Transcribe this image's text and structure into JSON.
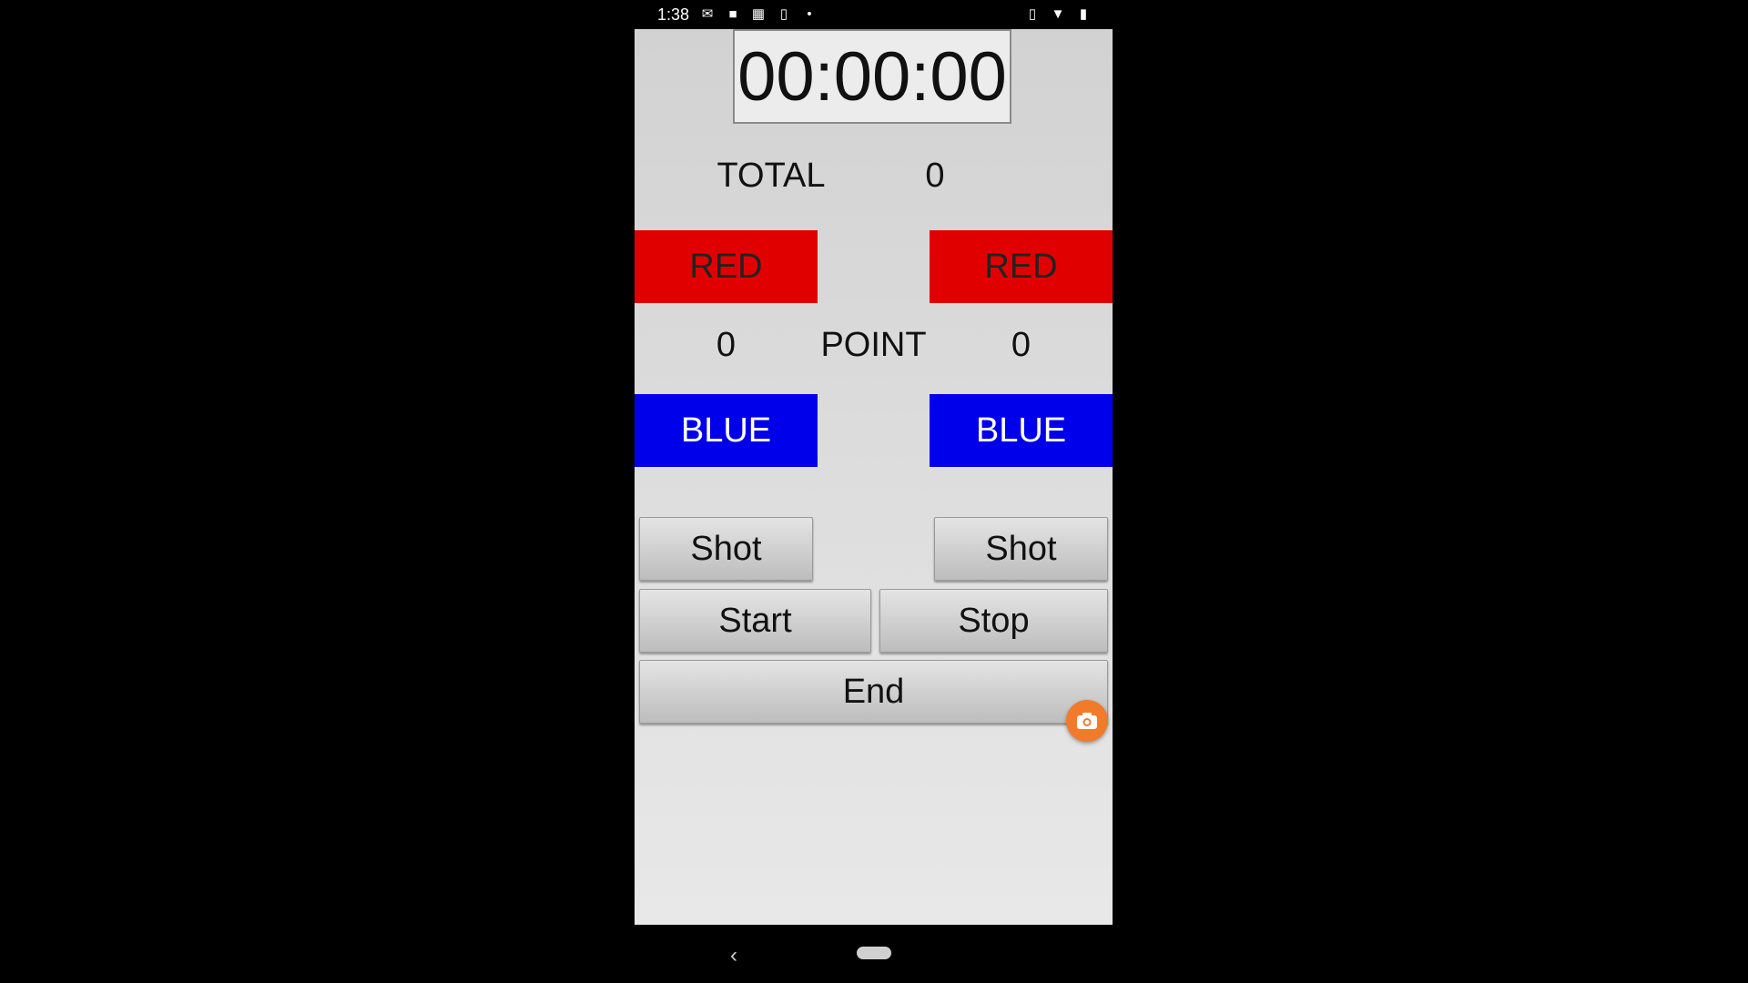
{
  "status_bar": {
    "time": "1:38",
    "left_icons": [
      "gmail-icon",
      "video-camera-icon",
      "calendar-icon",
      "phone-download-icon",
      "dot-icon"
    ],
    "right_icons": [
      "vibrate-icon",
      "wifi-icon",
      "battery-icon"
    ]
  },
  "timer": {
    "value": "00:00:00"
  },
  "total": {
    "label": "TOTAL",
    "value": "0"
  },
  "left_team": {
    "red_label": "RED",
    "blue_label": "BLUE",
    "points": "0",
    "shot_label": "Shot"
  },
  "right_team": {
    "red_label": "RED",
    "blue_label": "BLUE",
    "points": "0",
    "shot_label": "Shot"
  },
  "point_label": "POINT",
  "controls": {
    "start_label": "Start",
    "stop_label": "Stop",
    "end_label": "End"
  },
  "colors": {
    "red": "#e10000",
    "blue": "#0000ea",
    "fab": "#f27a2b"
  },
  "nav": {
    "back_icon": "back-icon",
    "home_icon": "home-pill-icon"
  }
}
